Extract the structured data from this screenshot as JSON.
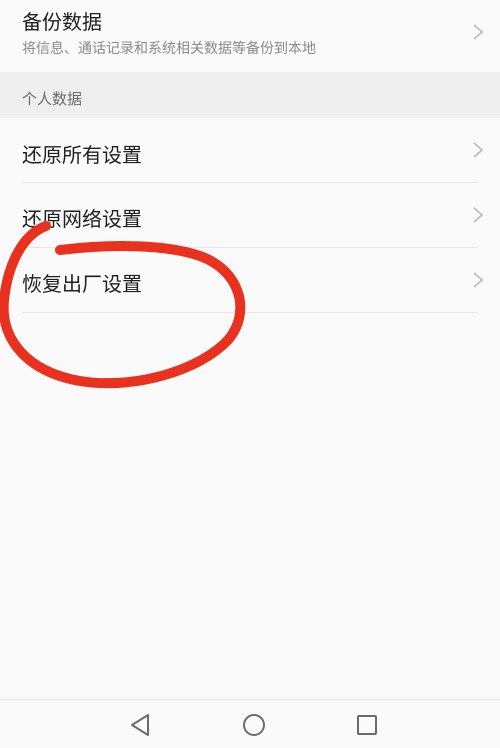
{
  "backup": {
    "title": "备份数据",
    "subtitle": "将信息、通话记录和系统相关数据等备份到本地"
  },
  "personal_section": {
    "label": "个人数据",
    "items": [
      {
        "label": "还原所有设置"
      },
      {
        "label": "还原网络设置"
      },
      {
        "label": "恢复出厂设置"
      }
    ]
  },
  "navbar": {
    "back_icon": "triangle-back-icon",
    "home_icon": "circle-home-icon",
    "recents_icon": "square-recents-icon"
  },
  "annotation": {
    "color": "#e8321f",
    "highlighted_item": "恢复出厂设置"
  },
  "colors": {
    "background": "#fafafa",
    "section_header": "#efefef",
    "chevron": "#b8b8b8"
  }
}
